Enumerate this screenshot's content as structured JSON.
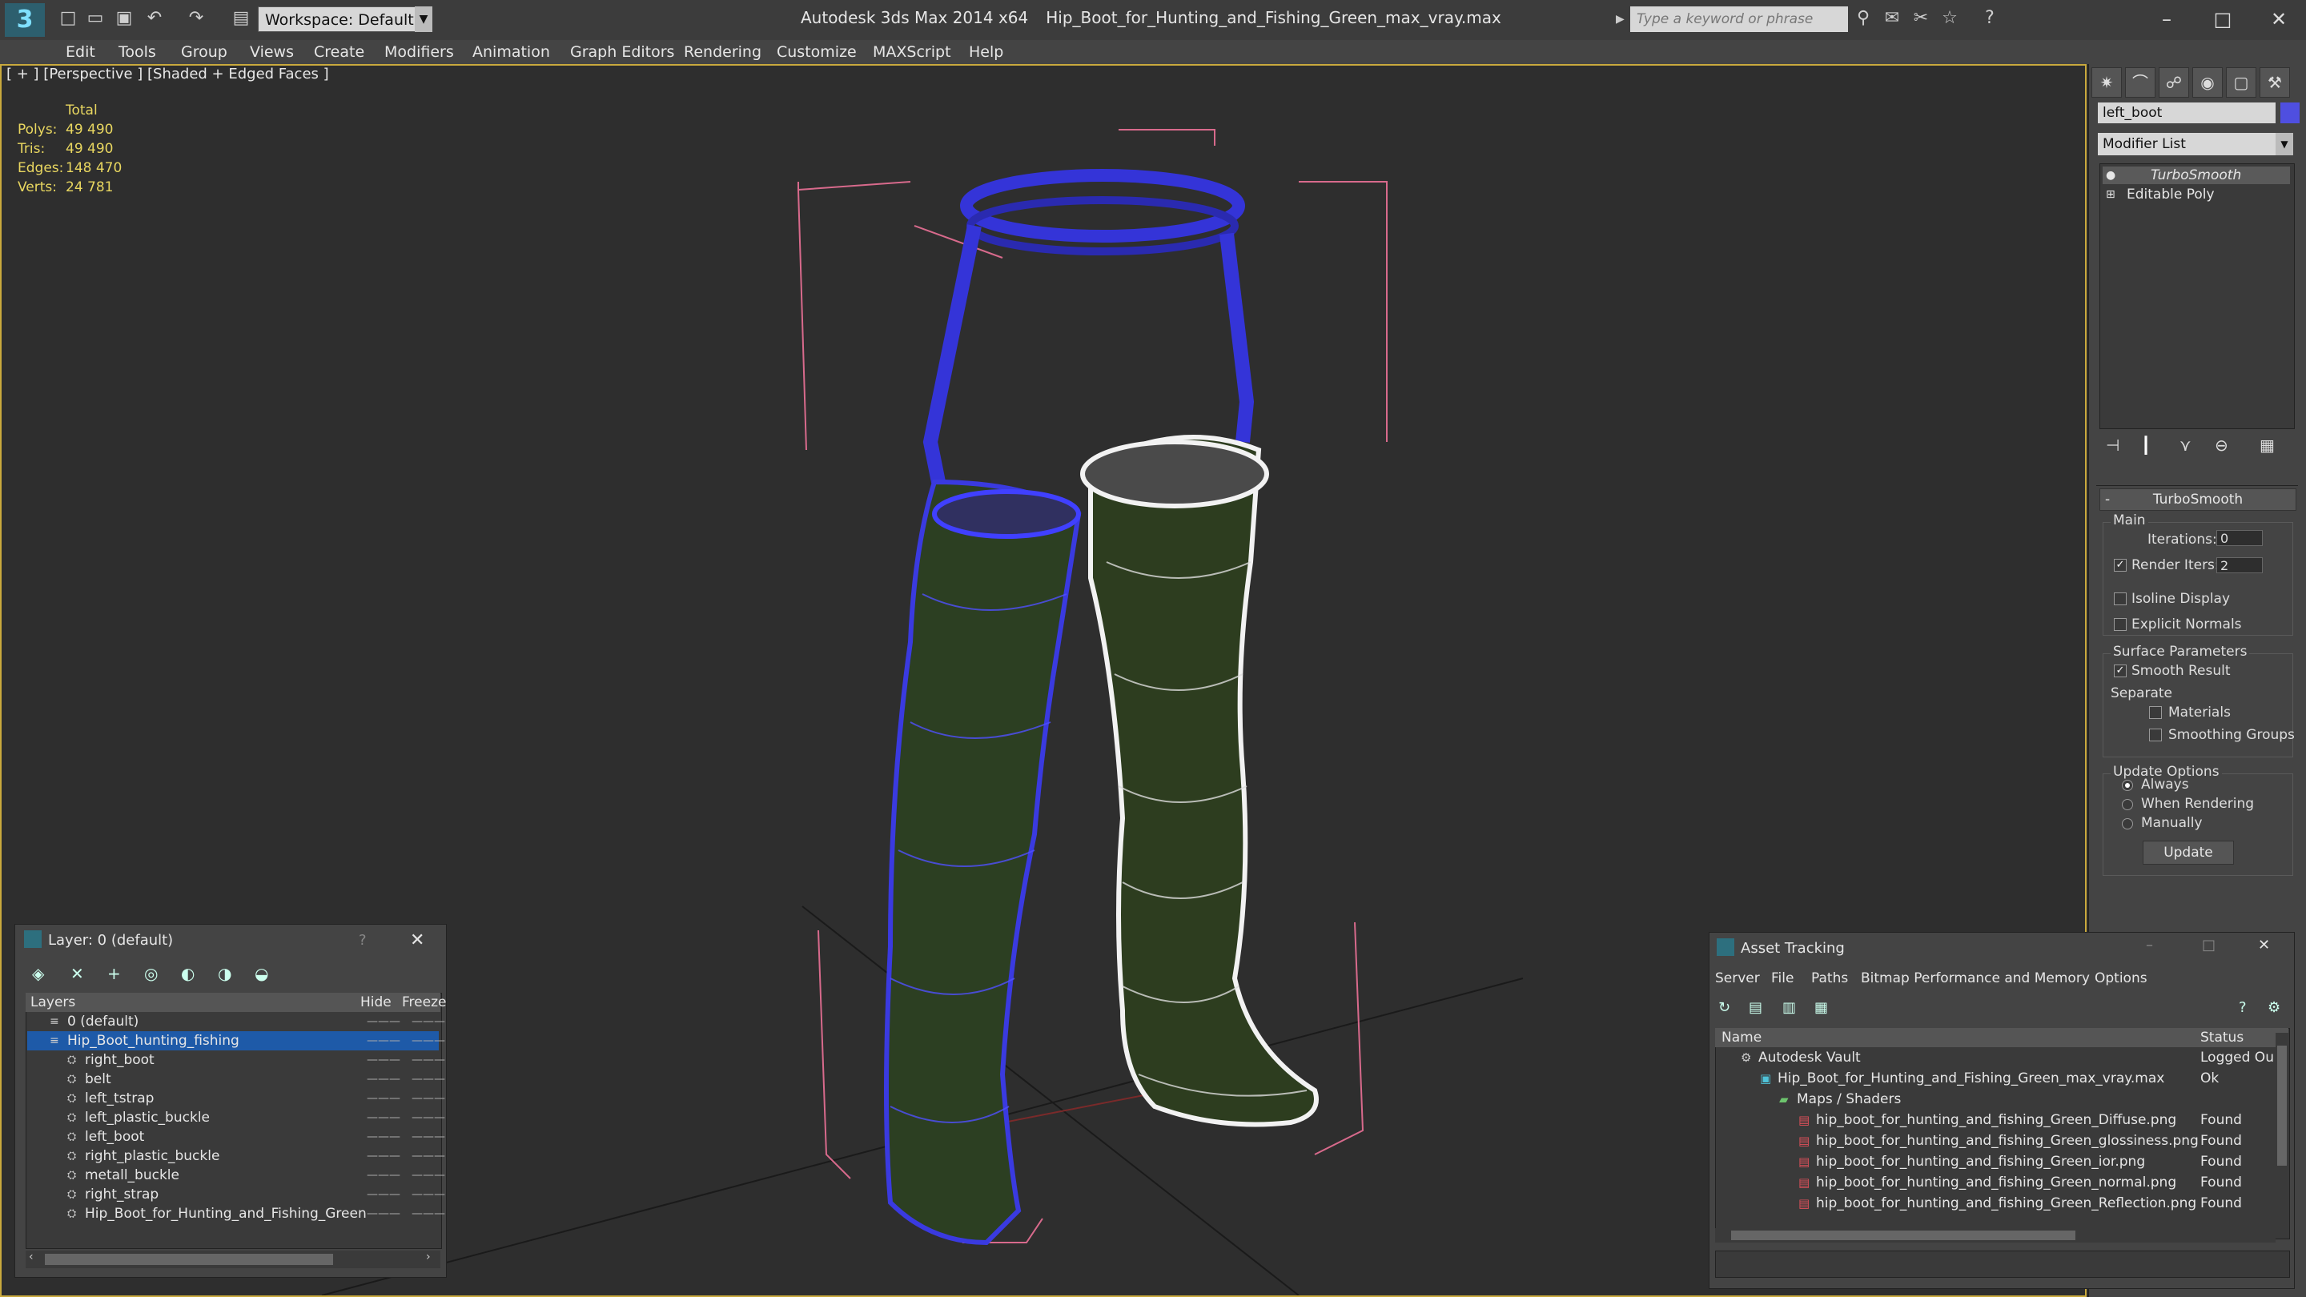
{
  "window": {
    "app_title": "Autodesk 3ds Max  2014 x64",
    "file_title": "Hip_Boot_for_Hunting_and_Fishing_Green_max_vray.max",
    "workspace_label": "Workspace: Default",
    "search_placeholder": "Type a keyword or phrase"
  },
  "menu": [
    "Edit",
    "Tools",
    "Group",
    "Views",
    "Create",
    "Modifiers",
    "Animation",
    "Graph Editors",
    "Rendering",
    "Customize",
    "MAXScript",
    "Help"
  ],
  "viewport": {
    "label": "[ + ] [Perspective ] [Shaded + Edged Faces ]",
    "stats_header": "Total",
    "stats": [
      {
        "label": "Polys:",
        "value": "49 490"
      },
      {
        "label": "Tris:",
        "value": "49 490"
      },
      {
        "label": "Edges:",
        "value": "148 470"
      },
      {
        "label": "Verts:",
        "value": "24 781"
      }
    ]
  },
  "command_panel": {
    "object_name": "left_boot",
    "object_color": "#4f4fe0",
    "modifier_list": "Modifier List",
    "stack": [
      "TurboSmooth",
      "Editable Poly"
    ],
    "rollout_title": "TurboSmooth",
    "main_group": "Main",
    "iterations_label": "Iterations:",
    "iterations_value": "0",
    "render_iters_label": "Render Iters:",
    "render_iters_value": "2",
    "isoline_label": "Isoline Display",
    "explicit_label": "Explicit Normals",
    "surface_group": "Surface Parameters",
    "smooth_result_label": "Smooth Result",
    "separate_label": "Separate",
    "materials_label": "Materials",
    "smoothing_groups_label": "Smoothing Groups",
    "update_group": "Update Options",
    "always_label": "Always",
    "when_rendering_label": "When Rendering",
    "manually_label": "Manually",
    "update_button": "Update"
  },
  "layer_window": {
    "title": "Layer: 0 (default)",
    "help": "?",
    "col_layers": "Layers",
    "col_hide": "Hide",
    "col_freeze": "Freeze",
    "rows": [
      {
        "name": "0 (default)",
        "indent": 0,
        "selected": false,
        "dashes": "———"
      },
      {
        "name": "Hip_Boot_hunting_fishing",
        "indent": 0,
        "selected": true,
        "dashes": "———"
      },
      {
        "name": "right_boot",
        "indent": 1,
        "selected": false,
        "dashes": "———"
      },
      {
        "name": "belt",
        "indent": 1,
        "selected": false,
        "dashes": "———"
      },
      {
        "name": "left_tstrap",
        "indent": 1,
        "selected": false,
        "dashes": "———"
      },
      {
        "name": "left_plastic_buckle",
        "indent": 1,
        "selected": false,
        "dashes": "———"
      },
      {
        "name": "left_boot",
        "indent": 1,
        "selected": false,
        "dashes": "———"
      },
      {
        "name": "right_plastic_buckle",
        "indent": 1,
        "selected": false,
        "dashes": "———"
      },
      {
        "name": "metall_buckle",
        "indent": 1,
        "selected": false,
        "dashes": "———"
      },
      {
        "name": "right_strap",
        "indent": 1,
        "selected": false,
        "dashes": "———"
      },
      {
        "name": "Hip_Boot_for_Hunting_and_Fishing_Green",
        "indent": 1,
        "selected": false,
        "dashes": "———"
      }
    ]
  },
  "asset_window": {
    "title": "Asset Tracking",
    "menu": [
      "Server",
      "File",
      "Paths",
      "Bitmap Performance and Memory",
      "Options"
    ],
    "col_name": "Name",
    "col_status": "Status",
    "rows": [
      {
        "name": "Autodesk Vault",
        "status": "Logged Ou",
        "indent": 0,
        "type": "vault"
      },
      {
        "name": "Hip_Boot_for_Hunting_and_Fishing_Green_max_vray.max",
        "status": "Ok",
        "indent": 1,
        "type": "max"
      },
      {
        "name": "Maps / Shaders",
        "status": "",
        "indent": 2,
        "type": "folder"
      },
      {
        "name": "hip_boot_for_hunting_and_fishing_Green_Diffuse.png",
        "status": "Found",
        "indent": 3,
        "type": "png"
      },
      {
        "name": "hip_boot_for_hunting_and_fishing_Green_glossiness.png",
        "status": "Found",
        "indent": 3,
        "type": "png"
      },
      {
        "name": "hip_boot_for_hunting_and_fishing_Green_ior.png",
        "status": "Found",
        "indent": 3,
        "type": "png"
      },
      {
        "name": "hip_boot_for_hunting_and_fishing_Green_normal.png",
        "status": "Found",
        "indent": 3,
        "type": "png"
      },
      {
        "name": "hip_boot_for_hunting_and_fishing_Green_Reflection.png",
        "status": "Found",
        "indent": 3,
        "type": "png"
      }
    ]
  }
}
